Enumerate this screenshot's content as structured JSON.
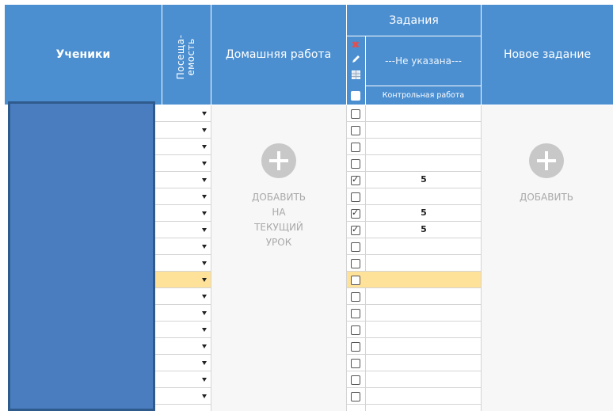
{
  "header": {
    "students": "Ученики",
    "attendance": "Посеща-\nемость",
    "homework": "Домашняя работа",
    "tasks": "Задания",
    "task_type_select": "---Не указана---",
    "task_name": "Контрольная работа",
    "new_task": "Новое задание"
  },
  "homework": {
    "add_label": "ДОБАВИТЬ\nНА\nТЕКУЩИЙ\nУРОК"
  },
  "new_task": {
    "add_label": "ДОБАВИТЬ"
  },
  "rows": [
    {
      "checked": false,
      "grade": "",
      "highlighted": false
    },
    {
      "checked": false,
      "grade": "",
      "highlighted": false
    },
    {
      "checked": false,
      "grade": "",
      "highlighted": false
    },
    {
      "checked": false,
      "grade": "",
      "highlighted": false
    },
    {
      "checked": true,
      "grade": "5",
      "highlighted": false
    },
    {
      "checked": false,
      "grade": "",
      "highlighted": false
    },
    {
      "checked": true,
      "grade": "5",
      "highlighted": false
    },
    {
      "checked": true,
      "grade": "5",
      "highlighted": false
    },
    {
      "checked": false,
      "grade": "",
      "highlighted": false
    },
    {
      "checked": false,
      "grade": "",
      "highlighted": false
    },
    {
      "checked": false,
      "grade": "",
      "highlighted": true
    },
    {
      "checked": false,
      "grade": "",
      "highlighted": false
    },
    {
      "checked": false,
      "grade": "",
      "highlighted": false
    },
    {
      "checked": false,
      "grade": "",
      "highlighted": false
    },
    {
      "checked": false,
      "grade": "",
      "highlighted": false
    },
    {
      "checked": false,
      "grade": "",
      "highlighted": false
    },
    {
      "checked": false,
      "grade": "",
      "highlighted": false
    },
    {
      "checked": false,
      "grade": "",
      "highlighted": false
    }
  ],
  "colors": {
    "header": "#4b8fd1",
    "students_panel": "#4a7dc0",
    "highlight": "#ffe29a",
    "delete_icon": "#e05050"
  },
  "icons": [
    "close-icon",
    "pencil-icon",
    "table-icon",
    "plus-icon",
    "dropdown-arrow-icon"
  ]
}
